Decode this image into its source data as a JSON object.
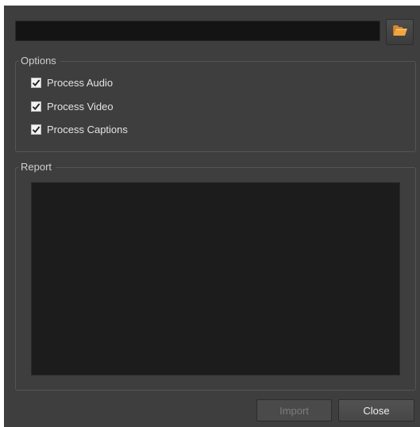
{
  "file_path": {
    "value": "",
    "placeholder": ""
  },
  "browse_button": {
    "icon": "folder-open-icon",
    "icon_color": "#e8a23c"
  },
  "options": {
    "title": "Options",
    "items": [
      {
        "label": "Process Audio",
        "checked": true
      },
      {
        "label": "Process Video",
        "checked": true
      },
      {
        "label": "Process Captions",
        "checked": true
      }
    ]
  },
  "report": {
    "title": "Report",
    "content": ""
  },
  "buttons": {
    "import_label": "Import",
    "import_enabled": false,
    "close_label": "Close"
  },
  "colors": {
    "dialog_bg": "#3e3e3e",
    "field_bg": "#141414",
    "report_bg": "#1c1c1c",
    "accent": "#e8a23c"
  }
}
